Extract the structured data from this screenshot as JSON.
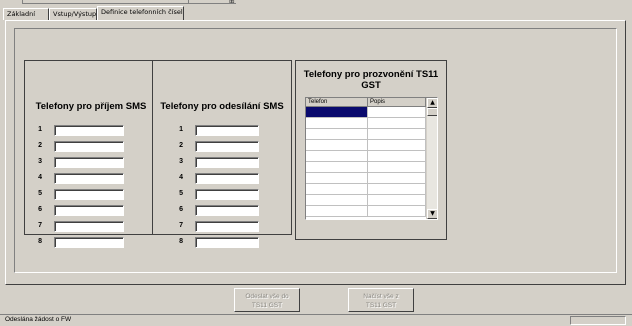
{
  "tabs": [
    {
      "label": "Základní",
      "active": false
    },
    {
      "label": "Vstup/Výstup",
      "active": false
    },
    {
      "label": "Definice telefonních čísel",
      "active": true
    }
  ],
  "receive_group": {
    "title": "Telefony pro příjem SMS",
    "rows": [
      {
        "num": "1",
        "value": ""
      },
      {
        "num": "2",
        "value": ""
      },
      {
        "num": "3",
        "value": ""
      },
      {
        "num": "4",
        "value": ""
      },
      {
        "num": "5",
        "value": ""
      },
      {
        "num": "6",
        "value": ""
      },
      {
        "num": "7",
        "value": ""
      },
      {
        "num": "8",
        "value": ""
      }
    ]
  },
  "send_group": {
    "title": "Telefony pro odesílání SMS",
    "rows": [
      {
        "num": "1",
        "value": ""
      },
      {
        "num": "2",
        "value": ""
      },
      {
        "num": "3",
        "value": ""
      },
      {
        "num": "4",
        "value": ""
      },
      {
        "num": "5",
        "value": ""
      },
      {
        "num": "6",
        "value": ""
      },
      {
        "num": "7",
        "value": ""
      },
      {
        "num": "8",
        "value": ""
      }
    ]
  },
  "call_group": {
    "title_line1": "Telefony pro prozvonění TS11",
    "title_line2": "GST",
    "columns": [
      "Telefon",
      "Popis"
    ],
    "scroll_up_icon": "arrow-up-icon",
    "scroll_down_icon": "arrow-down-icon"
  },
  "buttons": {
    "send_all_line1": "Odeslat vše do",
    "send_all_line2": "TS11 GST",
    "load_all_line1": "Načíst vše z",
    "load_all_line2": "TS11 GST"
  },
  "status": {
    "text": "Odeslána žádost o FW"
  }
}
